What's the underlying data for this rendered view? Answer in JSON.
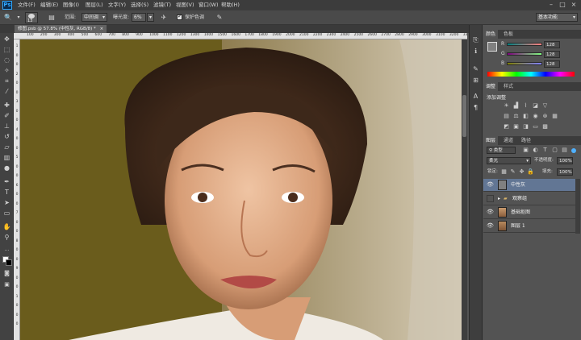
{
  "app": {
    "logo": "Ps"
  },
  "menu": [
    "文件(F)",
    "编辑(E)",
    "图像(I)",
    "图层(L)",
    "文字(Y)",
    "选择(S)",
    "滤镜(T)",
    "视图(V)",
    "窗口(W)",
    "帮助(H)"
  ],
  "options": {
    "brush_size": "13",
    "range_label": "范围:",
    "range_value": "中间调",
    "exposure_label": "曝光度:",
    "exposure_value": "6%",
    "protect_tones_label": "保护色调",
    "protect_tones_checked": true,
    "workspace": "基本功能"
  },
  "document_tab": {
    "title": "修图.psb @ 57.8% (中性灰, RGB/8) *",
    "close": "×"
  },
  "ruler": {
    "h_ticks": [
      "100",
      "200",
      "300",
      "400",
      "500",
      "600",
      "700",
      "800",
      "900",
      "1000",
      "1100",
      "1200",
      "1300",
      "1400",
      "1500",
      "1600",
      "1700",
      "1800",
      "1900",
      "2000",
      "2100",
      "2200",
      "2300",
      "2400",
      "2500",
      "2600",
      "2700",
      "2800",
      "2900",
      "3000",
      "3100",
      "3200",
      "3300"
    ],
    "v_ticks": [
      "1",
      "0",
      "0",
      "2",
      "0",
      "0",
      "3",
      "0",
      "0",
      "4",
      "0",
      "0",
      "5",
      "0",
      "0",
      "6",
      "0",
      "0",
      "7",
      "0",
      "0",
      "8",
      "0",
      "0",
      "9",
      "0",
      "0",
      "1",
      "0",
      "0",
      "0"
    ]
  },
  "color_panel": {
    "tabs": [
      "颜色",
      "色板"
    ],
    "channels": [
      {
        "label": "R",
        "value": "128"
      },
      {
        "label": "G",
        "value": "128"
      },
      {
        "label": "B",
        "value": "128"
      }
    ]
  },
  "adjustments_panel": {
    "tabs": [
      "调整",
      "样式"
    ],
    "heading": "添加调整"
  },
  "layers_panel": {
    "tabs": [
      "图层",
      "通道",
      "路径"
    ],
    "filter_kind": "类型",
    "blend_mode": "柔光",
    "opacity_label": "不透明度:",
    "opacity_value": "100%",
    "lock_label": "锁定:",
    "fill_label": "填充:",
    "fill_value": "100%",
    "layers": [
      {
        "name": "中性灰",
        "selected": true,
        "visible": true,
        "thumb": "#808080"
      },
      {
        "name": "观察组",
        "selected": false,
        "visible": false,
        "is_group": true
      },
      {
        "name": "基础抠图",
        "selected": false,
        "visible": true,
        "thumb": "#b98a5c"
      },
      {
        "name": "图层 1",
        "selected": false,
        "visible": true,
        "thumb": "#a57a4f"
      }
    ]
  },
  "colors": {
    "accent": "#31a8ff",
    "selected_layer": "#627694",
    "canvas_bg": "#6b5d1e",
    "panel_bg": "#535353"
  },
  "icons": {
    "tools": [
      "move-icon",
      "marquee-icon",
      "lasso-icon",
      "quick-select-icon",
      "crop-icon",
      "eyedropper-icon",
      "healing-icon",
      "brush-icon",
      "stamp-icon",
      "history-brush-icon",
      "eraser-icon",
      "gradient-icon",
      "dodge-icon",
      "pen-icon",
      "type-icon",
      "path-select-icon",
      "shape-icon",
      "hand-icon",
      "zoom-icon"
    ]
  }
}
